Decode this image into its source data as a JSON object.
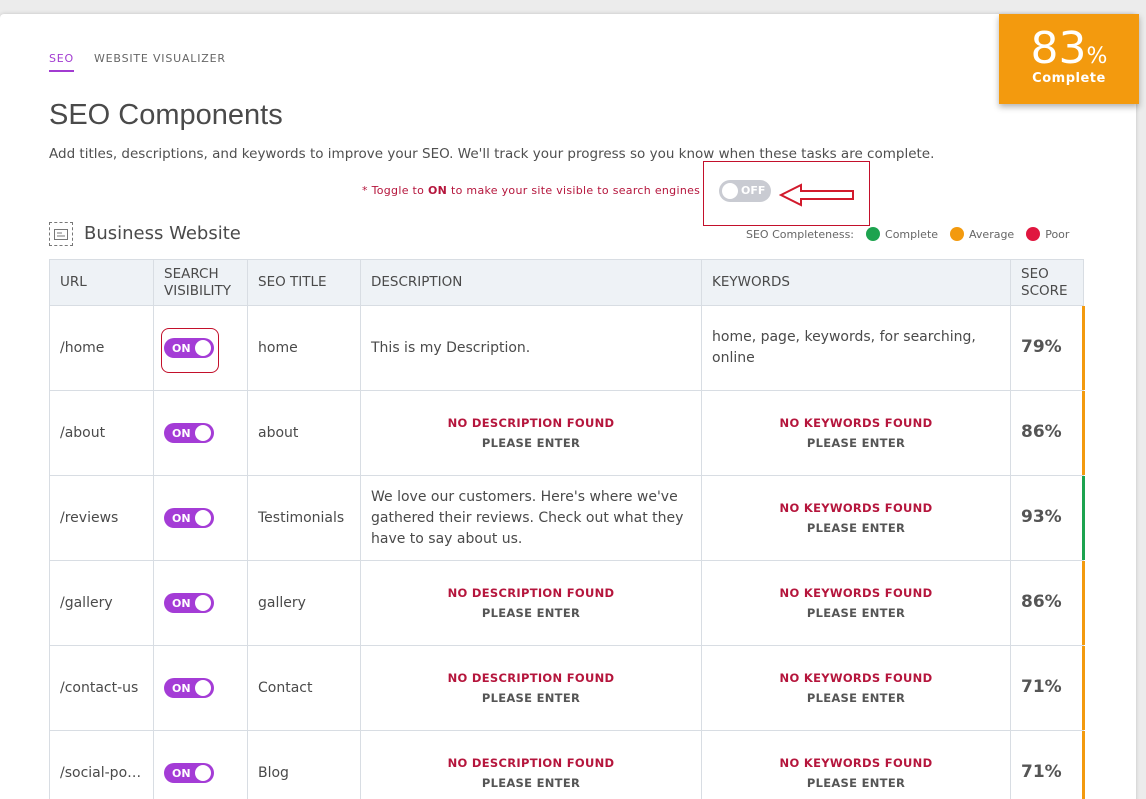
{
  "tabs": [
    {
      "label": "SEO"
    },
    {
      "label": "WEBSITE VISUALIZER"
    }
  ],
  "page": {
    "title": "SEO Components",
    "description": "Add titles, descriptions, and keywords to improve your SEO. We'll track your progress so you know when these tasks are complete.",
    "toggle_note_prefix": "* Toggle to ",
    "toggle_note_on": "ON",
    "toggle_note_suffix": " to make your site visible to search engines"
  },
  "site_toggle": {
    "label": "OFF",
    "state": "off"
  },
  "section": {
    "title": "Business Website"
  },
  "legend": {
    "title": "SEO Completeness:",
    "items": [
      {
        "label": "Complete",
        "color": "#1da34f"
      },
      {
        "label": "Average",
        "color": "#f39a0e"
      },
      {
        "label": "Poor",
        "color": "#e0163f"
      }
    ]
  },
  "score_badge": {
    "value": "83",
    "unit": "%",
    "label": "Complete"
  },
  "table": {
    "headers": [
      "URL",
      "SEARCH VISIBILITY",
      "SEO TITLE",
      "DESCRIPTION",
      "KEYWORDS",
      "SEO SCORE"
    ],
    "missing_description": "NO DESCRIPTION FOUND",
    "missing_keywords": "NO KEYWORDS FOUND",
    "please_enter": "PLEASE ENTER",
    "rows": [
      {
        "url": "/home",
        "visibility": "ON",
        "title": "home",
        "description": "This is my Description.",
        "keywords": "home, page, keywords, for searching, online",
        "score": "79%",
        "status_color": "#f39a0e"
      },
      {
        "url": "/about",
        "visibility": "ON",
        "title": "about",
        "description": "",
        "keywords": "",
        "score": "86%",
        "status_color": "#f39a0e"
      },
      {
        "url": "/reviews",
        "visibility": "ON",
        "title": "Testimonials",
        "description": "We love our customers. Here's where we've gathered their reviews. Check out what they have to say about us.",
        "keywords": "",
        "score": "93%",
        "status_color": "#1da34f"
      },
      {
        "url": "/gallery",
        "visibility": "ON",
        "title": "gallery",
        "description": "",
        "keywords": "",
        "score": "86%",
        "status_color": "#f39a0e"
      },
      {
        "url": "/contact-us",
        "visibility": "ON",
        "title": "Contact",
        "description": "",
        "keywords": "",
        "score": "71%",
        "status_color": "#f39a0e"
      },
      {
        "url": "/social-po…",
        "visibility": "ON",
        "title": "Blog",
        "description": "",
        "keywords": "",
        "score": "71%",
        "status_color": "#f39a0e"
      }
    ]
  }
}
